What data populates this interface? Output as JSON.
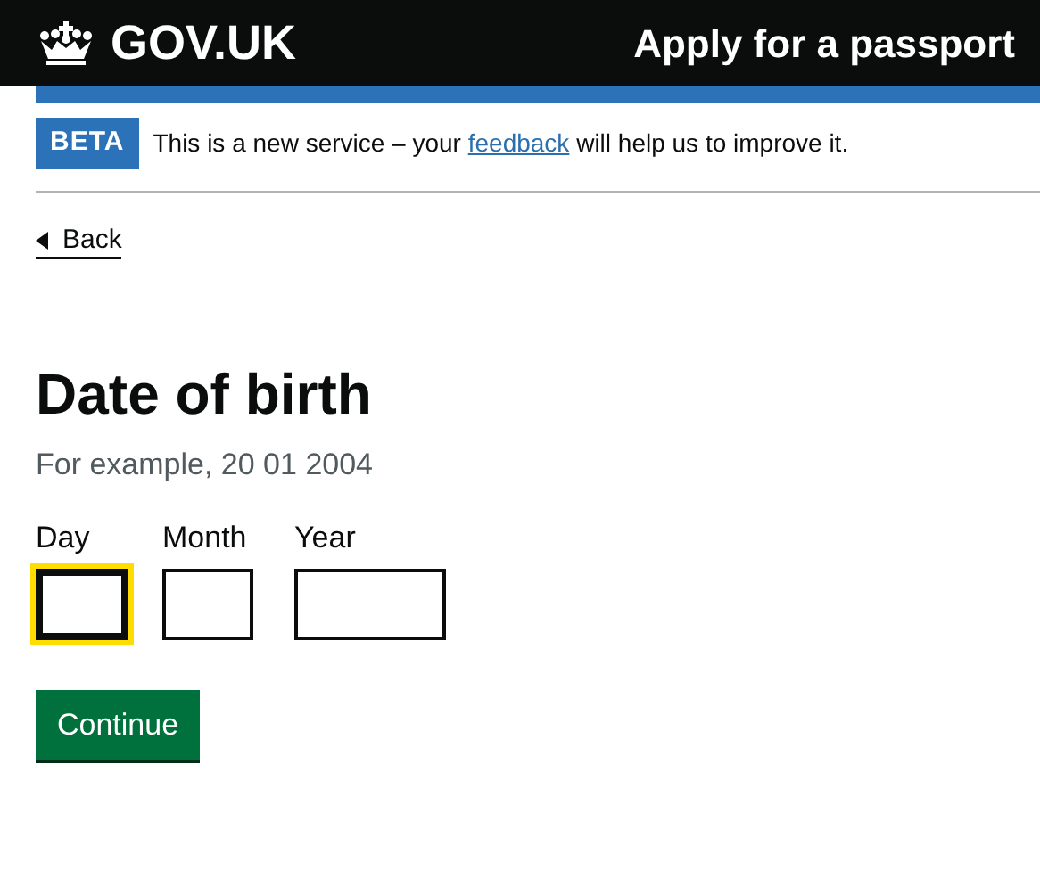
{
  "header": {
    "logo": "GOV.UK",
    "service_name": "Apply for a passport"
  },
  "phase_banner": {
    "tag": "BETA",
    "text_before": "This is a new service – your",
    "link": "feedback",
    "text_after": "will help us to improve it."
  },
  "back_link": "Back",
  "heading": "Date of birth",
  "hint": "For example, 20 01 2004",
  "date_fields": [
    {
      "label": "Day",
      "focused": true
    },
    {
      "label": "Month",
      "focused": false
    },
    {
      "label": "Year",
      "focused": false
    }
  ],
  "buttons": [
    "Continue"
  ]
}
